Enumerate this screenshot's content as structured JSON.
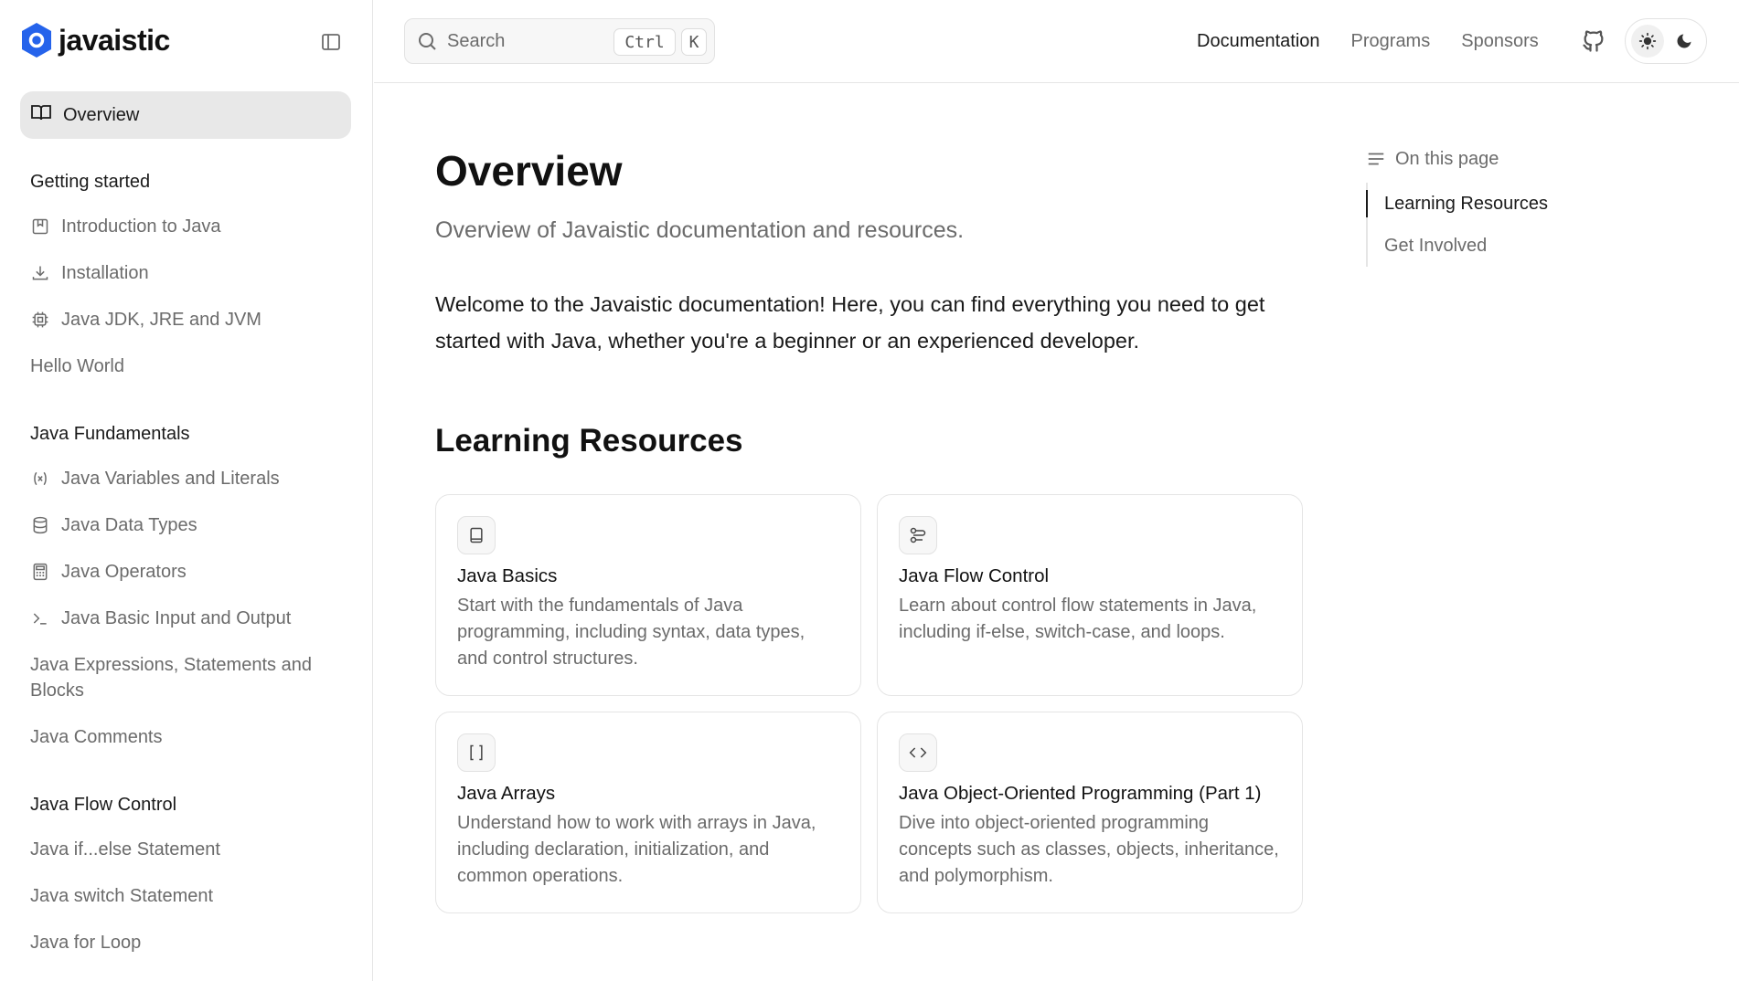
{
  "brand": {
    "name": "javaistic",
    "accent": "#2563eb"
  },
  "sidebar": {
    "overview_label": "Overview",
    "groups": [
      {
        "title": "Getting started",
        "items": [
          {
            "label": "Introduction to Java",
            "icon": "bookmark-book-icon"
          },
          {
            "label": "Installation",
            "icon": "download-icon"
          },
          {
            "label": "Java JDK, JRE and JVM",
            "icon": "cpu-icon"
          },
          {
            "label": "Hello World",
            "icon": ""
          }
        ]
      },
      {
        "title": "Java Fundamentals",
        "items": [
          {
            "label": "Java Variables and Literals",
            "icon": "variable-icon"
          },
          {
            "label": "Java Data Types",
            "icon": "database-icon"
          },
          {
            "label": "Java Operators",
            "icon": "calculator-icon"
          },
          {
            "label": "Java Basic Input and Output",
            "icon": "terminal-icon"
          },
          {
            "label": "Java Expressions, Statements and Blocks",
            "icon": ""
          },
          {
            "label": "Java Comments",
            "icon": ""
          }
        ]
      },
      {
        "title": "Java Flow Control",
        "items": [
          {
            "label": "Java if...else Statement",
            "icon": ""
          },
          {
            "label": "Java switch Statement",
            "icon": ""
          },
          {
            "label": "Java for Loop",
            "icon": ""
          }
        ]
      }
    ]
  },
  "header": {
    "search_placeholder": "Search",
    "kbd_ctrl": "Ctrl",
    "kbd_k": "K",
    "links": [
      "Documentation",
      "Programs",
      "Sponsors"
    ],
    "active_link": "Documentation",
    "theme": "light"
  },
  "main": {
    "title": "Overview",
    "description": "Overview of Javaistic documentation and resources.",
    "intro": "Welcome to the Javaistic documentation! Here, you can find everything you need to get started with Java, whether you're a beginner or an experienced developer.",
    "section_title": "Learning Resources",
    "cards": [
      {
        "title": "Java Basics",
        "description": "Start with the fundamentals of Java programming, including syntax, data types, and control structures.",
        "icon": "book-icon"
      },
      {
        "title": "Java Flow Control",
        "description": "Learn about control flow statements in Java, including if-else, switch-case, and loops.",
        "icon": "flow-icon"
      },
      {
        "title": "Java Arrays",
        "description": "Understand how to work with arrays in Java, including declaration, initialization, and common operations.",
        "icon": "brackets-icon"
      },
      {
        "title": "Java Object-Oriented Programming (Part 1)",
        "description": "Dive into object-oriented programming concepts such as classes, objects, inheritance, and polymorphism.",
        "icon": "code-icon"
      }
    ]
  },
  "toc": {
    "heading": "On this page",
    "items": [
      "Learning Resources",
      "Get Involved"
    ],
    "active": "Learning Resources"
  }
}
